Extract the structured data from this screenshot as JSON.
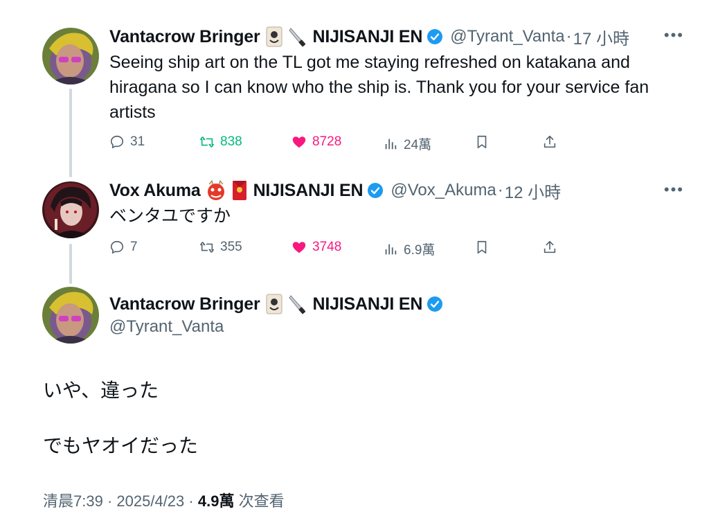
{
  "tweet1": {
    "name": "Vantacrow Bringer",
    "org": "NIJISANJI EN",
    "handle": "@Tyrant_Vanta",
    "time": "17 小時",
    "text_line1": "Seeing ship art on the TL got me staying refreshed on katakana and",
    "text_line2": "hiragana so I can know who the ship is. Thank you for your service fan",
    "text_line3": "artists",
    "replies": "31",
    "retweets": "838",
    "likes": "8728",
    "views": "24萬",
    "emoji": [
      "card-joker-icon",
      "knife-icon"
    ]
  },
  "tweet2": {
    "name": "Vox Akuma",
    "org": "NIJISANJI EN",
    "handle": "@Vox_Akuma",
    "time": "12 小時",
    "text": "ベンタユですか",
    "replies": "7",
    "retweets": "355",
    "likes": "3748",
    "views": "6.9萬",
    "emoji": [
      "oni-mask-icon",
      "red-envelope-icon"
    ]
  },
  "main": {
    "name": "Vantacrow Bringer",
    "org": "NIJISANJI EN",
    "handle": "@Tyrant_Vanta",
    "line1": "いや、違った",
    "line2": "でもヤオイだった",
    "timestamp": "清晨7:39",
    "date": "2025/4/23",
    "views_count": "4.9萬",
    "views_label": "次查看"
  },
  "colors": {
    "verified": "#1d9bf0",
    "retweet": "#00ba7c",
    "like": "#f91880",
    "secondary": "#536471"
  }
}
